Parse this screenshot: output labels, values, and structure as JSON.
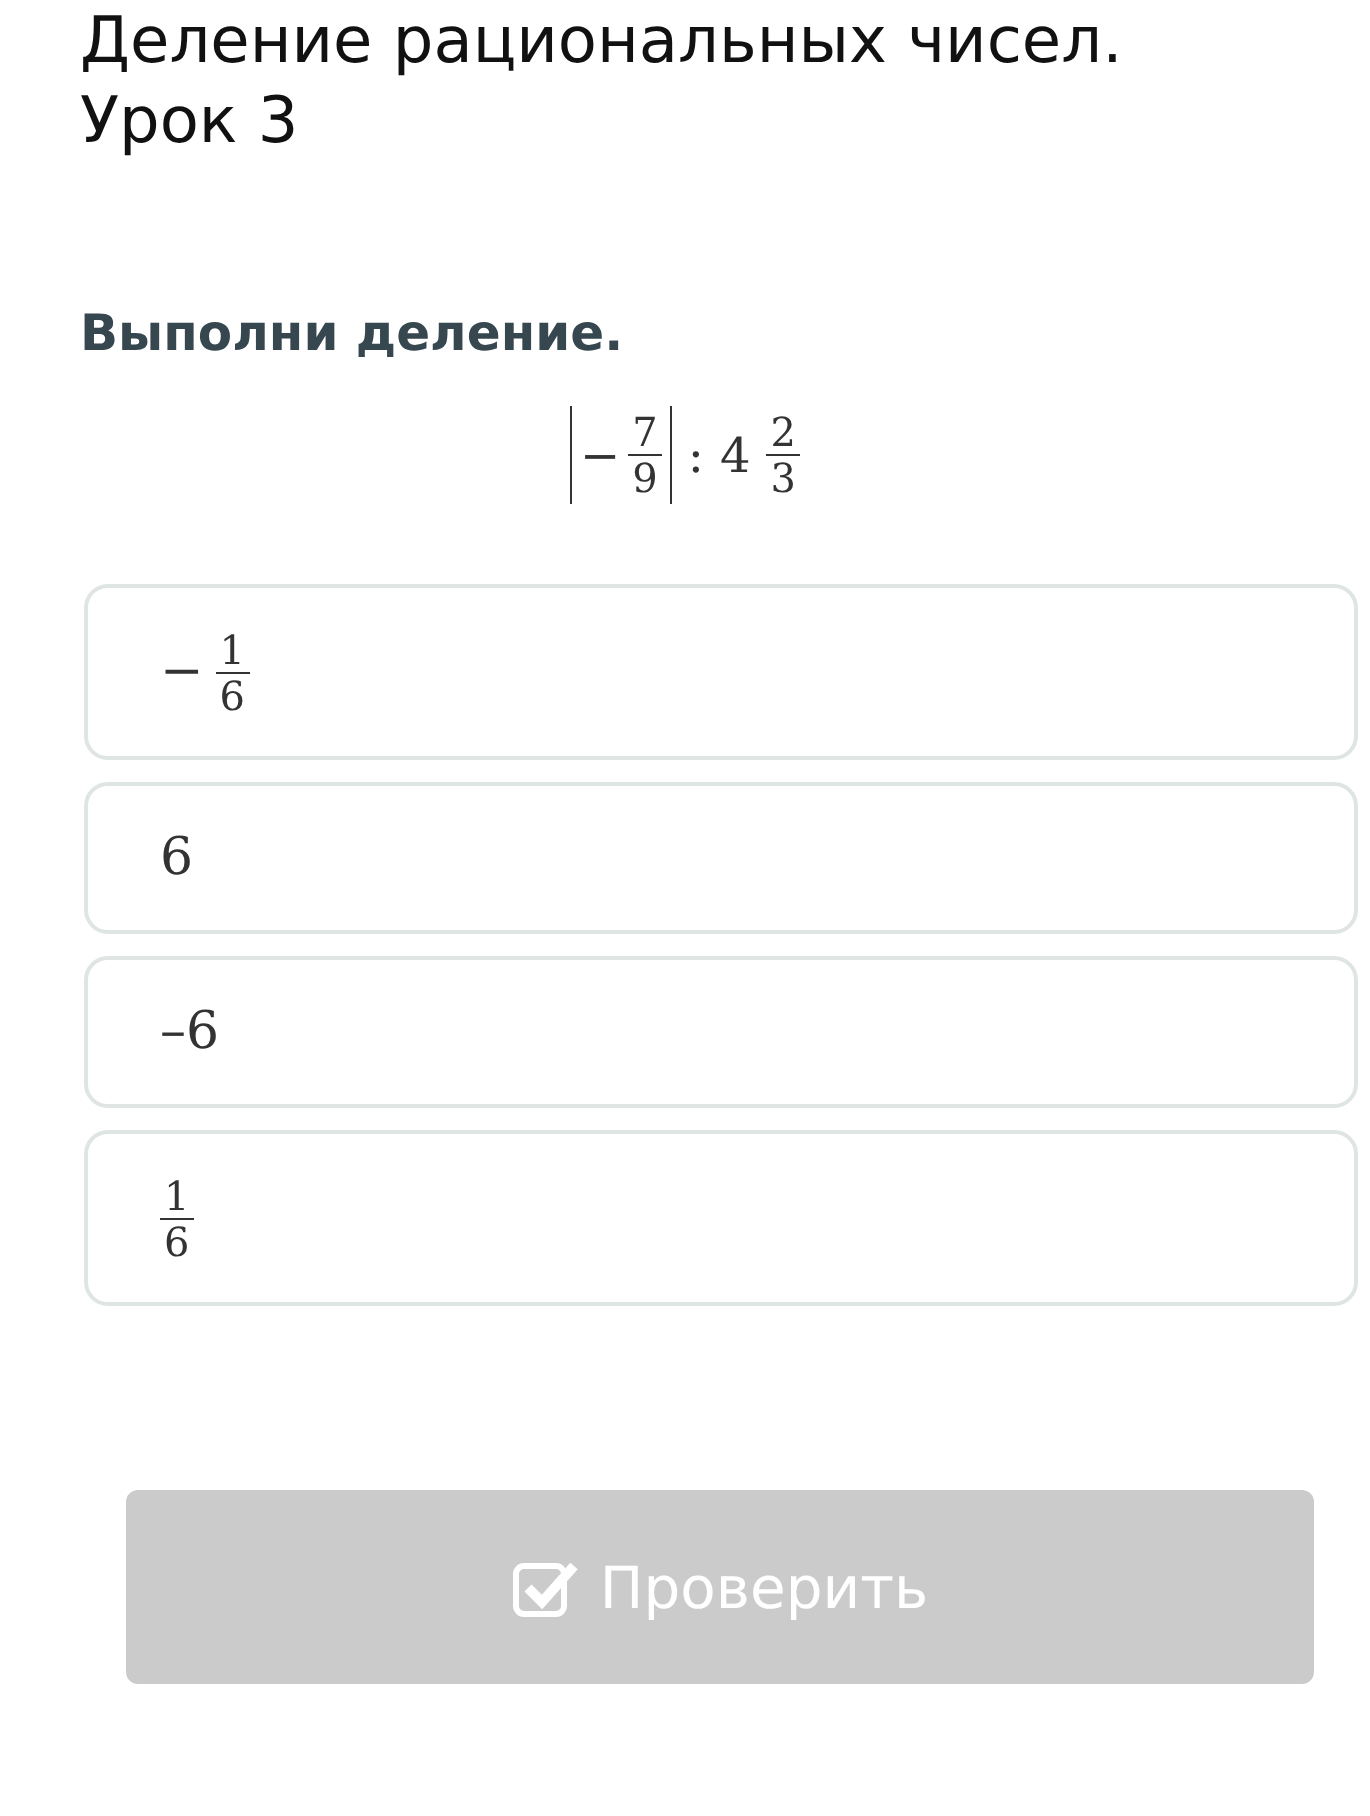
{
  "title": [
    "Деление рациональных чисел.",
    "Урок 3"
  ],
  "question": "Выполни деление.",
  "expression": {
    "abs_sign": "−",
    "abs_numerator": "7",
    "abs_denominator": "9",
    "operator": ":",
    "whole": "4",
    "numerator": "2",
    "denominator": "3"
  },
  "options": [
    {
      "kind": "fraction",
      "sign": "−",
      "numerator": "1",
      "denominator": "6",
      "selected": false
    },
    {
      "kind": "number",
      "text": "6",
      "selected": false
    },
    {
      "kind": "number",
      "text": "–6",
      "selected": false
    },
    {
      "kind": "fraction",
      "numerator": "1",
      "denominator": "6",
      "selected": false
    }
  ],
  "check_button": {
    "label": "Проверить",
    "disabled": true
  }
}
